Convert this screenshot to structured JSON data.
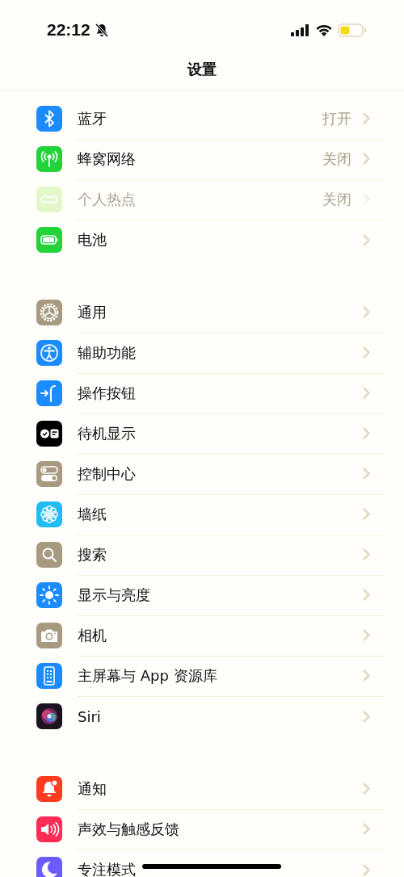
{
  "status_bar": {
    "time": "22:12"
  },
  "nav_bar": {
    "title": "设置"
  },
  "groups": [
    {
      "rows": [
        {
          "kind": "bluetooth",
          "color": "#1a8cff",
          "label": "蓝牙",
          "value": "打开",
          "disabled": false
        },
        {
          "kind": "cellular",
          "color": "#22d43a",
          "label": "蜂窝网络",
          "value": "关闭",
          "disabled": false
        },
        {
          "kind": "hotspot",
          "color": "#e2f8c8",
          "label": "个人热点",
          "value": "关闭",
          "disabled": true
        },
        {
          "kind": "battery",
          "color": "#22d43a",
          "label": "电池",
          "disabled": false
        }
      ]
    },
    {
      "rows": [
        {
          "kind": "gear",
          "color": "#a89a80",
          "label": "通用",
          "disabled": false
        },
        {
          "kind": "accessibility",
          "color": "#1a8cff",
          "label": "辅助功能",
          "disabled": false
        },
        {
          "kind": "action",
          "color": "#1a8cff",
          "label": "操作按钮",
          "disabled": false
        },
        {
          "kind": "standby",
          "color": "#000000",
          "label": "待机显示",
          "disabled": false
        },
        {
          "kind": "toggles",
          "color": "#a89a80",
          "label": "控制中心",
          "disabled": false
        },
        {
          "kind": "flower",
          "color": "#1fbcf5",
          "label": "墙纸",
          "disabled": false
        },
        {
          "kind": "search",
          "color": "#a89a80",
          "label": "搜索",
          "disabled": false
        },
        {
          "kind": "sun",
          "color": "#1a8cff",
          "label": "显示与亮度",
          "disabled": false
        },
        {
          "kind": "camera",
          "color": "#a89a80",
          "label": "相机",
          "disabled": false
        },
        {
          "kind": "phone",
          "color": "#1a8cff",
          "label": "主屏幕与 App 资源库",
          "disabled": false
        },
        {
          "kind": "siri",
          "color": "#1b1420",
          "label": "Siri",
          "disabled": false
        }
      ]
    },
    {
      "rows": [
        {
          "kind": "bell",
          "color": "#ff3b20",
          "label": "通知",
          "disabled": false
        },
        {
          "kind": "speaker",
          "color": "#ff2d55",
          "label": "声效与触感反馈",
          "disabled": false
        },
        {
          "kind": "moon",
          "color": "#6a5cff",
          "label": "专注模式",
          "disabled": false
        }
      ]
    }
  ]
}
